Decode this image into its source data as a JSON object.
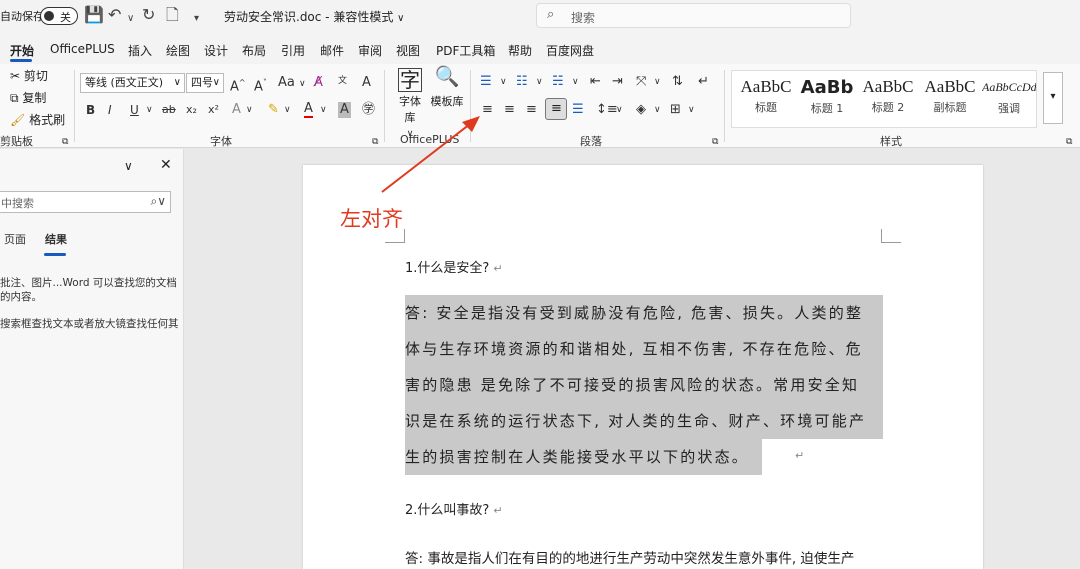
{
  "titlebar": {
    "autosave_label": "自动保存",
    "autosave_state": "关",
    "doc_title": "劳动安全常识.doc  -  兼容性模式",
    "doc_title_arrow": "∨",
    "search_placeholder": "搜索"
  },
  "tabs": [
    {
      "label": "开始",
      "active": true
    },
    {
      "label": "OfficePLUS"
    },
    {
      "label": "插入"
    },
    {
      "label": "绘图"
    },
    {
      "label": "设计"
    },
    {
      "label": "布局"
    },
    {
      "label": "引用"
    },
    {
      "label": "邮件"
    },
    {
      "label": "审阅"
    },
    {
      "label": "视图"
    },
    {
      "label": "PDF工具箱"
    },
    {
      "label": "帮助"
    },
    {
      "label": "百度网盘"
    }
  ],
  "ribbon": {
    "clipboard": {
      "cut": "剪切",
      "copy": "复制",
      "format_painter": "格式刷",
      "label": "剪贴板"
    },
    "font": {
      "font_name": "等线 (西文正文)",
      "font_size": "四号",
      "label": "字体",
      "grow": "A^",
      "shrink": "A˅",
      "case": "Aa",
      "bold": "B",
      "italic": "I",
      "underline": "U",
      "strike": "ab",
      "sub": "x₂",
      "sup": "x²"
    },
    "officeplus": {
      "font_lib": "字体库",
      "template_lib": "模板库",
      "label": "OfficePLUS"
    },
    "paragraph": {
      "label": "段落"
    },
    "styles": {
      "label": "样式",
      "items": [
        {
          "sample": "AaBbC",
          "name": "标题"
        },
        {
          "sample": "AaBb",
          "name": "标题 1"
        },
        {
          "sample": "AaBbC",
          "name": "标题 2"
        },
        {
          "sample": "AaBbC",
          "name": "副标题"
        },
        {
          "sample": "AaBbCcDd",
          "name": "强调"
        }
      ]
    }
  },
  "navpane": {
    "search_placeholder": "中搜索",
    "tab_pages": "页面",
    "tab_results": "结果",
    "text1": "批注、图片...Word 可以查找您的文档",
    "text2": "的内容。",
    "text3": "搜索框查找文本或者放大镜查找任何其"
  },
  "annotation": "左对齐",
  "document": {
    "q1": "1.什么是安全?",
    "a1_lines": [
      "答: 安全是指没有受到威胁没有危险, 危害、损失。人类的整",
      "体与生存环境资源的和谐相处, 互相不伤害, 不存在危险、危",
      "害的隐患  是免除了不可接受的损害风险的状态。常用安全知",
      "识是在系统的运行状态下, 对人类的生命、财产、环境可能产",
      "生的损害控制在人类能接受水平以下的状态。"
    ],
    "q2": "2.什么叫事故?",
    "a2": "答: 事故是指人们在有目的的地进行生产劳动中突然发生意外事件, 迫使生产",
    "para_mark": "↵"
  },
  "colors": {
    "accent": "#185abd",
    "annotation": "#e03a1e",
    "highlight": "#c9c9c9"
  }
}
